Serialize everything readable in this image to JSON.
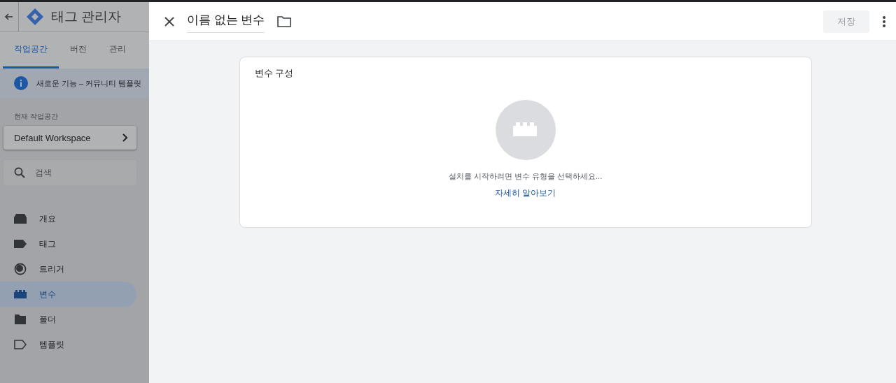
{
  "app": {
    "title": "태그 관리자",
    "tabs": [
      {
        "label": "작업공간",
        "selected": true
      },
      {
        "label": "버전",
        "selected": false
      },
      {
        "label": "관리",
        "selected": false
      }
    ],
    "banner": "새로운 기능 – 커뮤니티 템플릿",
    "workspace": {
      "caption": "현재 작업공간",
      "name": "Default Workspace"
    },
    "search": {
      "placeholder": "검색"
    },
    "nav": [
      {
        "label": "개요",
        "kind": "overview",
        "selected": false
      },
      {
        "label": "태그",
        "kind": "tag",
        "selected": false
      },
      {
        "label": "트리거",
        "kind": "trigger",
        "selected": false
      },
      {
        "label": "변수",
        "kind": "variable",
        "selected": true
      },
      {
        "label": "폴더",
        "kind": "folder",
        "selected": false
      },
      {
        "label": "템플릿",
        "kind": "template",
        "selected": false
      }
    ]
  },
  "editor": {
    "title": "이름 없는 변수",
    "save": {
      "label": "저장",
      "disabled": true
    },
    "card": {
      "title": "변수 구성",
      "message": "설치를 시작하려면 변수 유형을 선택하세요...",
      "link": "자세히 알아보기"
    }
  }
}
